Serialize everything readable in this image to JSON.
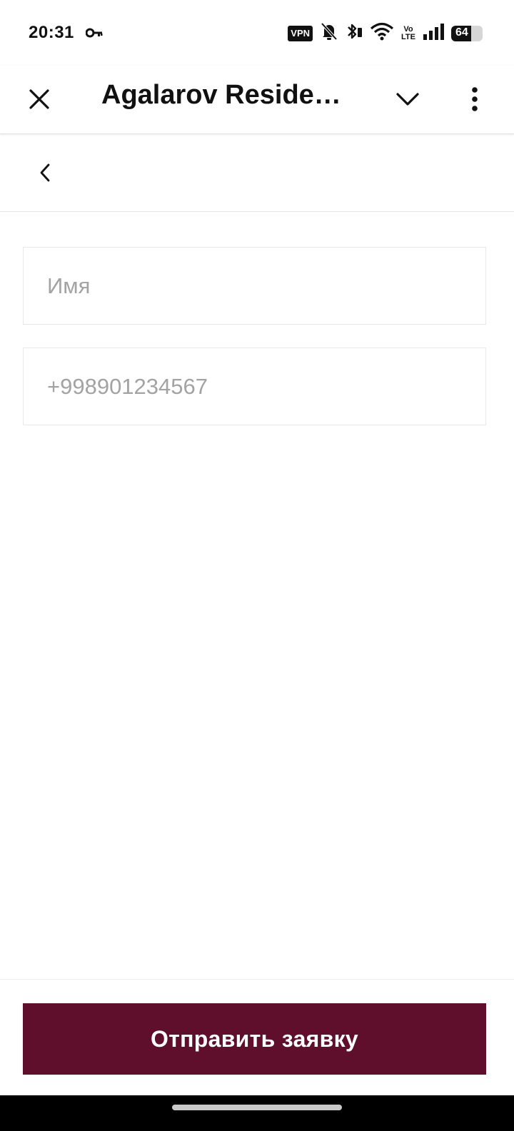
{
  "status_bar": {
    "time": "20:31",
    "vpn": "VPN",
    "volte_top": "Vo",
    "volte_bottom": "LTE",
    "battery": "64",
    "battery_level": 0.64
  },
  "app_bar": {
    "title": "Agalarov Residen…"
  },
  "form": {
    "name_placeholder": "Имя",
    "phone_placeholder": "+998901234567"
  },
  "submit": {
    "label": "Отправить заявку",
    "color": "#5f0f2c"
  }
}
